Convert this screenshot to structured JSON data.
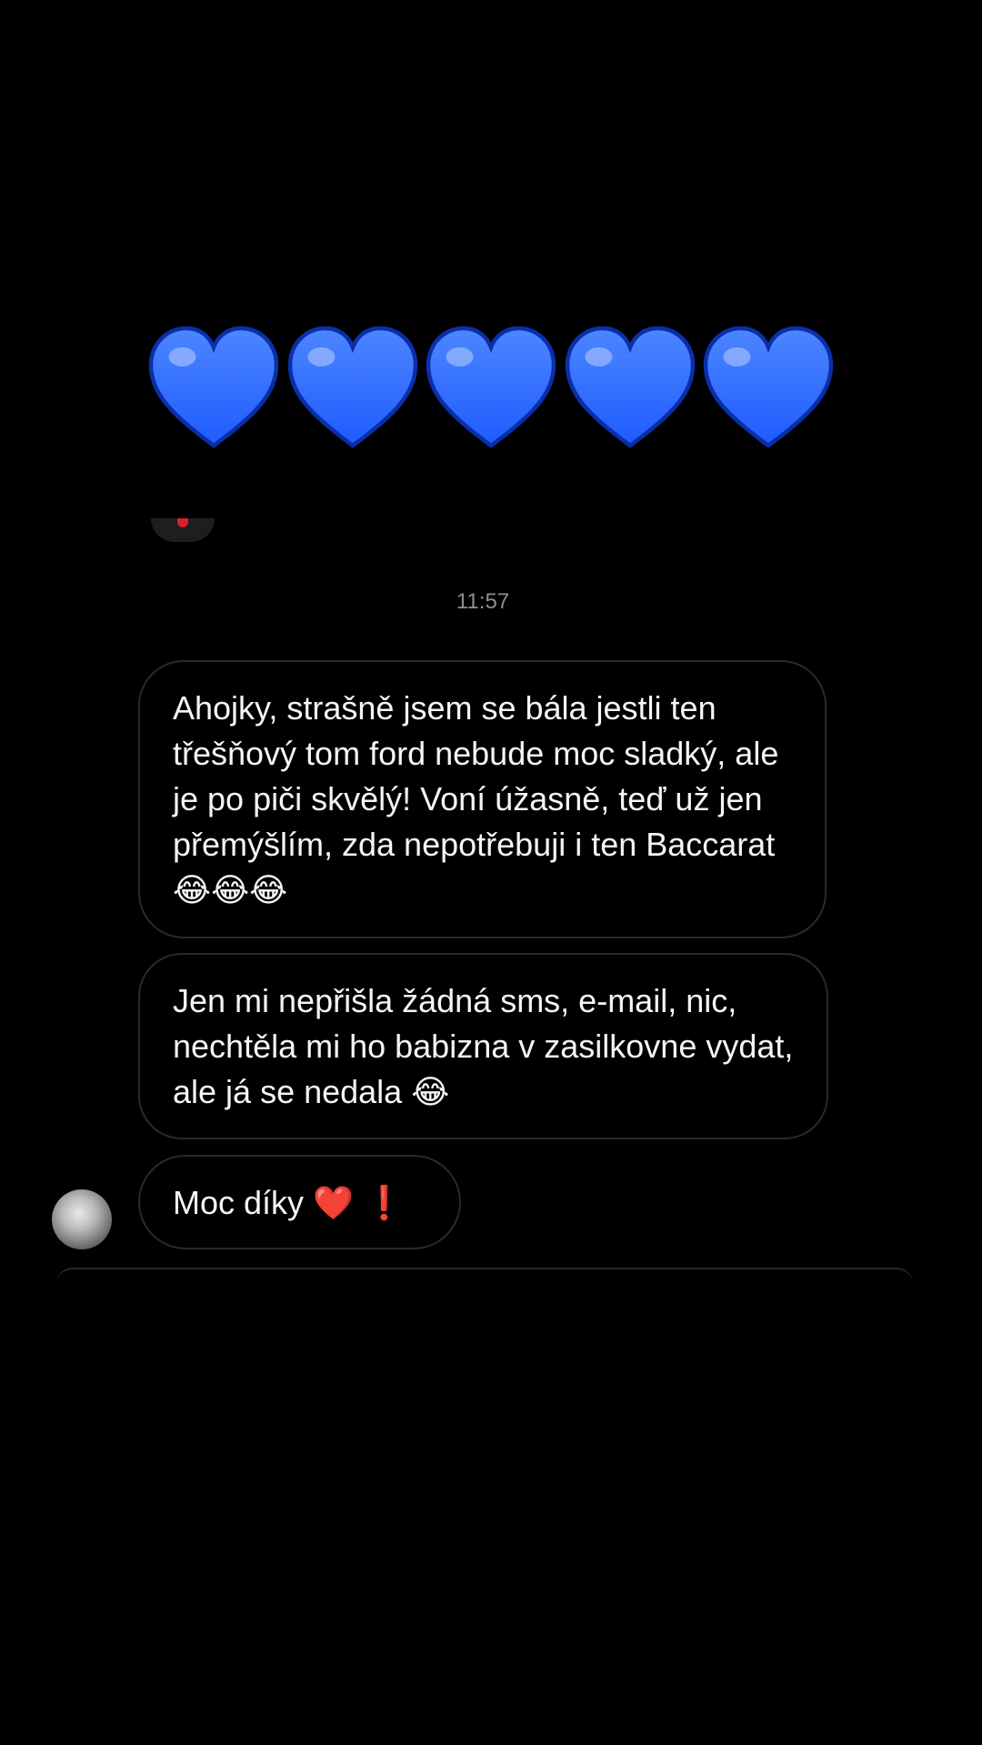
{
  "hearts": {
    "count": 5,
    "icon": "blue-heart-icon",
    "color": "#1e5bff"
  },
  "conversation": {
    "timestamp": "11:57",
    "messages": [
      {
        "text": "Ahojky, strašně jsem se bála jestli ten třešňový tom ford nebude moc sladký, ale je po piči skvělý! Voní úžasně, teď už jen přemýšlím, zda nepotřebuji i ten Baccarat",
        "emoji": "😂😂😂"
      },
      {
        "text": "Jen mi nepřišla žádná sms, e-mail, nic, nechtěla mi ho babizna v zasilkovne vydat, ale já se nedala",
        "emoji": "😂"
      },
      {
        "text": "Moc díky",
        "emoji": "❤️ ❗"
      }
    ]
  },
  "colors": {
    "background": "#000000",
    "bubble_border": "#2a2a2a",
    "timestamp_text": "#8e8e8e",
    "message_text": "#f5f5f5"
  }
}
